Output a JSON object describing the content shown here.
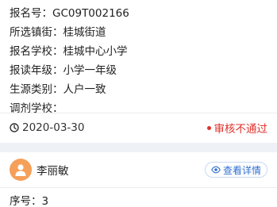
{
  "record": {
    "rows": [
      {
        "label": "报名号：",
        "value": "GC09T002166"
      },
      {
        "label": "所选镇街：",
        "value": "桂城街道"
      },
      {
        "label": "报名学校：",
        "value": "桂城中心小学"
      },
      {
        "label": "报读年级：",
        "value": "小学一年级"
      },
      {
        "label": "生源类别：",
        "value": "人户一致"
      },
      {
        "label": "调剂学校：",
        "value": ""
      }
    ],
    "date": "2020-03-30",
    "status": "审核不通过"
  },
  "next_card": {
    "name": "李丽敏",
    "detail_label": "查看详情",
    "seq_label": "序号：",
    "seq_value": "3"
  },
  "colors": {
    "status": "#e0312b",
    "avatar": "#f5a05a",
    "link": "#2f6fd1"
  }
}
